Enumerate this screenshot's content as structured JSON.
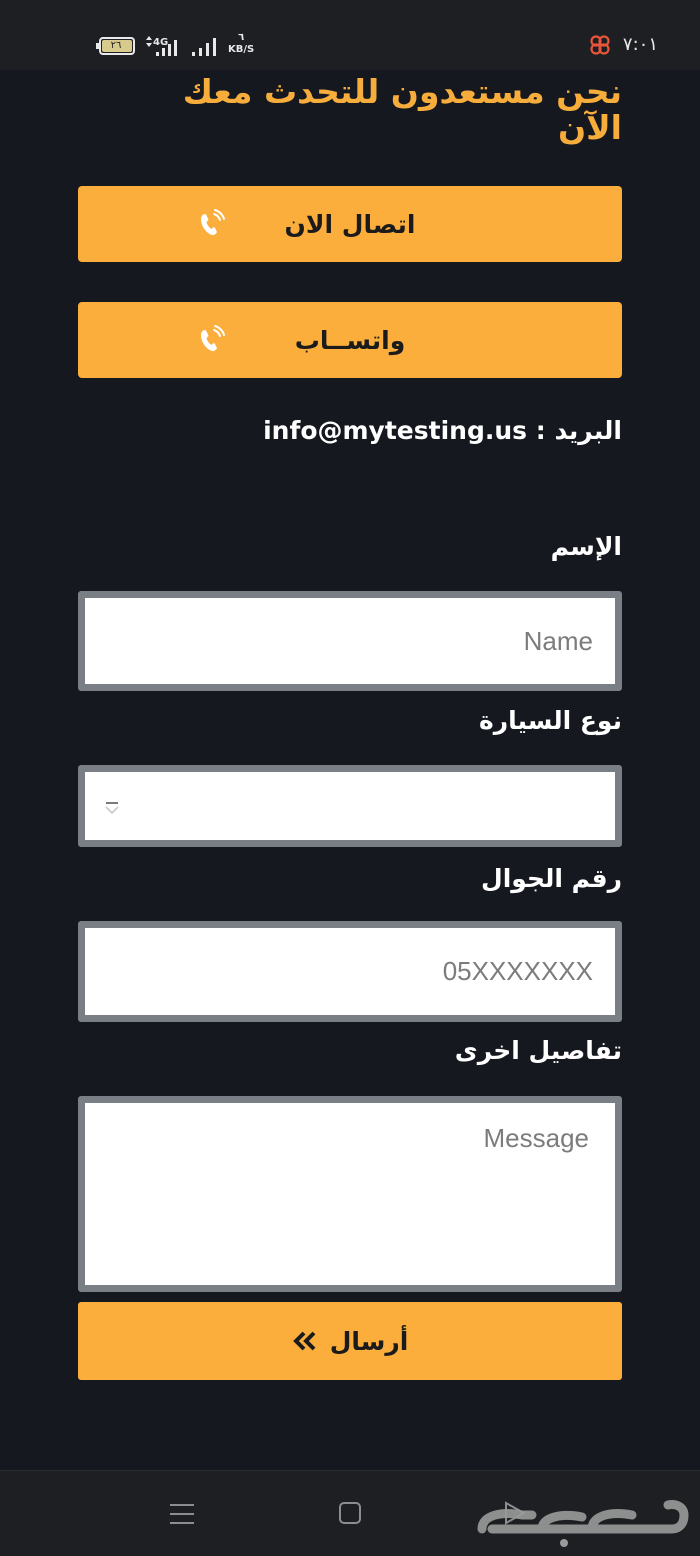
{
  "status_bar": {
    "time": "٧:٠١",
    "battery": "٢٦",
    "network": "4G",
    "speed_value": "٦",
    "speed_unit": "KB/S"
  },
  "contact": {
    "heading": "نحن مستعدون للتحدث معك الآن",
    "call_button": "اتصال الان",
    "whatsapp_button": "واتســاب",
    "email_label": "البريد :",
    "email_value": "info@mytesting.us"
  },
  "form": {
    "name_label": "الإسم",
    "name_placeholder": "Name",
    "car_label": "نوع السيارة",
    "car_value": "",
    "phone_label": "رقم الجوال",
    "phone_placeholder": "05XXXXXXX",
    "details_label": "تفاصيل اخرى",
    "details_placeholder": "Message",
    "submit_label": "أرسال"
  },
  "icons": {
    "call": "phone-ringing-icon",
    "whatsapp": "phone-ringing-icon",
    "submit": "double-chevron-icon",
    "nav_menu": "menu-icon",
    "nav_home": "home-square-icon",
    "nav_back": "back-triangle-icon"
  },
  "colors": {
    "accent": "#fbae3c",
    "heading": "#f7ad3b",
    "background": "#15181f",
    "field_border": "#7a7f86"
  }
}
